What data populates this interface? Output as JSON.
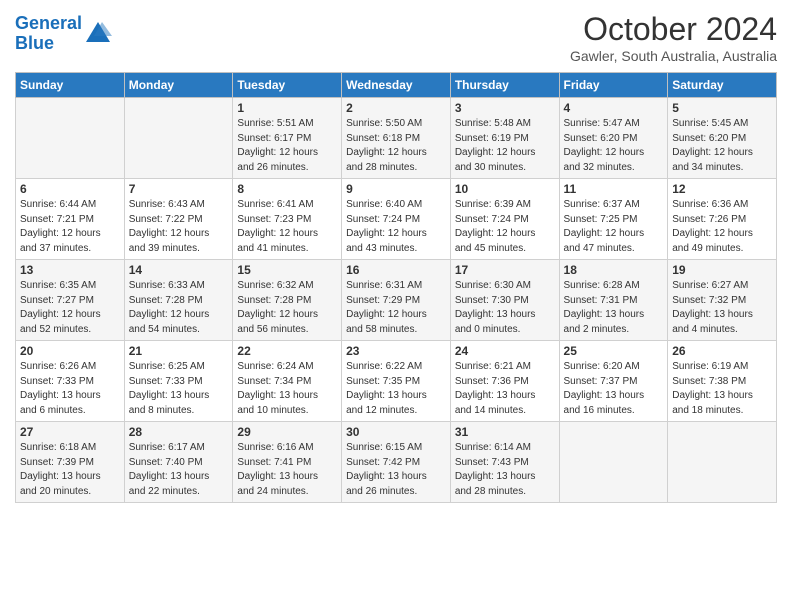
{
  "header": {
    "logo_line1": "General",
    "logo_line2": "Blue",
    "month": "October 2024",
    "location": "Gawler, South Australia, Australia"
  },
  "days_of_week": [
    "Sunday",
    "Monday",
    "Tuesday",
    "Wednesday",
    "Thursday",
    "Friday",
    "Saturday"
  ],
  "weeks": [
    [
      {
        "day": "",
        "info": ""
      },
      {
        "day": "",
        "info": ""
      },
      {
        "day": "1",
        "info": "Sunrise: 5:51 AM\nSunset: 6:17 PM\nDaylight: 12 hours\nand 26 minutes."
      },
      {
        "day": "2",
        "info": "Sunrise: 5:50 AM\nSunset: 6:18 PM\nDaylight: 12 hours\nand 28 minutes."
      },
      {
        "day": "3",
        "info": "Sunrise: 5:48 AM\nSunset: 6:19 PM\nDaylight: 12 hours\nand 30 minutes."
      },
      {
        "day": "4",
        "info": "Sunrise: 5:47 AM\nSunset: 6:20 PM\nDaylight: 12 hours\nand 32 minutes."
      },
      {
        "day": "5",
        "info": "Sunrise: 5:45 AM\nSunset: 6:20 PM\nDaylight: 12 hours\nand 34 minutes."
      }
    ],
    [
      {
        "day": "6",
        "info": "Sunrise: 6:44 AM\nSunset: 7:21 PM\nDaylight: 12 hours\nand 37 minutes."
      },
      {
        "day": "7",
        "info": "Sunrise: 6:43 AM\nSunset: 7:22 PM\nDaylight: 12 hours\nand 39 minutes."
      },
      {
        "day": "8",
        "info": "Sunrise: 6:41 AM\nSunset: 7:23 PM\nDaylight: 12 hours\nand 41 minutes."
      },
      {
        "day": "9",
        "info": "Sunrise: 6:40 AM\nSunset: 7:24 PM\nDaylight: 12 hours\nand 43 minutes."
      },
      {
        "day": "10",
        "info": "Sunrise: 6:39 AM\nSunset: 7:24 PM\nDaylight: 12 hours\nand 45 minutes."
      },
      {
        "day": "11",
        "info": "Sunrise: 6:37 AM\nSunset: 7:25 PM\nDaylight: 12 hours\nand 47 minutes."
      },
      {
        "day": "12",
        "info": "Sunrise: 6:36 AM\nSunset: 7:26 PM\nDaylight: 12 hours\nand 49 minutes."
      }
    ],
    [
      {
        "day": "13",
        "info": "Sunrise: 6:35 AM\nSunset: 7:27 PM\nDaylight: 12 hours\nand 52 minutes."
      },
      {
        "day": "14",
        "info": "Sunrise: 6:33 AM\nSunset: 7:28 PM\nDaylight: 12 hours\nand 54 minutes."
      },
      {
        "day": "15",
        "info": "Sunrise: 6:32 AM\nSunset: 7:28 PM\nDaylight: 12 hours\nand 56 minutes."
      },
      {
        "day": "16",
        "info": "Sunrise: 6:31 AM\nSunset: 7:29 PM\nDaylight: 12 hours\nand 58 minutes."
      },
      {
        "day": "17",
        "info": "Sunrise: 6:30 AM\nSunset: 7:30 PM\nDaylight: 13 hours\nand 0 minutes."
      },
      {
        "day": "18",
        "info": "Sunrise: 6:28 AM\nSunset: 7:31 PM\nDaylight: 13 hours\nand 2 minutes."
      },
      {
        "day": "19",
        "info": "Sunrise: 6:27 AM\nSunset: 7:32 PM\nDaylight: 13 hours\nand 4 minutes."
      }
    ],
    [
      {
        "day": "20",
        "info": "Sunrise: 6:26 AM\nSunset: 7:33 PM\nDaylight: 13 hours\nand 6 minutes."
      },
      {
        "day": "21",
        "info": "Sunrise: 6:25 AM\nSunset: 7:33 PM\nDaylight: 13 hours\nand 8 minutes."
      },
      {
        "day": "22",
        "info": "Sunrise: 6:24 AM\nSunset: 7:34 PM\nDaylight: 13 hours\nand 10 minutes."
      },
      {
        "day": "23",
        "info": "Sunrise: 6:22 AM\nSunset: 7:35 PM\nDaylight: 13 hours\nand 12 minutes."
      },
      {
        "day": "24",
        "info": "Sunrise: 6:21 AM\nSunset: 7:36 PM\nDaylight: 13 hours\nand 14 minutes."
      },
      {
        "day": "25",
        "info": "Sunrise: 6:20 AM\nSunset: 7:37 PM\nDaylight: 13 hours\nand 16 minutes."
      },
      {
        "day": "26",
        "info": "Sunrise: 6:19 AM\nSunset: 7:38 PM\nDaylight: 13 hours\nand 18 minutes."
      }
    ],
    [
      {
        "day": "27",
        "info": "Sunrise: 6:18 AM\nSunset: 7:39 PM\nDaylight: 13 hours\nand 20 minutes."
      },
      {
        "day": "28",
        "info": "Sunrise: 6:17 AM\nSunset: 7:40 PM\nDaylight: 13 hours\nand 22 minutes."
      },
      {
        "day": "29",
        "info": "Sunrise: 6:16 AM\nSunset: 7:41 PM\nDaylight: 13 hours\nand 24 minutes."
      },
      {
        "day": "30",
        "info": "Sunrise: 6:15 AM\nSunset: 7:42 PM\nDaylight: 13 hours\nand 26 minutes."
      },
      {
        "day": "31",
        "info": "Sunrise: 6:14 AM\nSunset: 7:43 PM\nDaylight: 13 hours\nand 28 minutes."
      },
      {
        "day": "",
        "info": ""
      },
      {
        "day": "",
        "info": ""
      }
    ]
  ]
}
